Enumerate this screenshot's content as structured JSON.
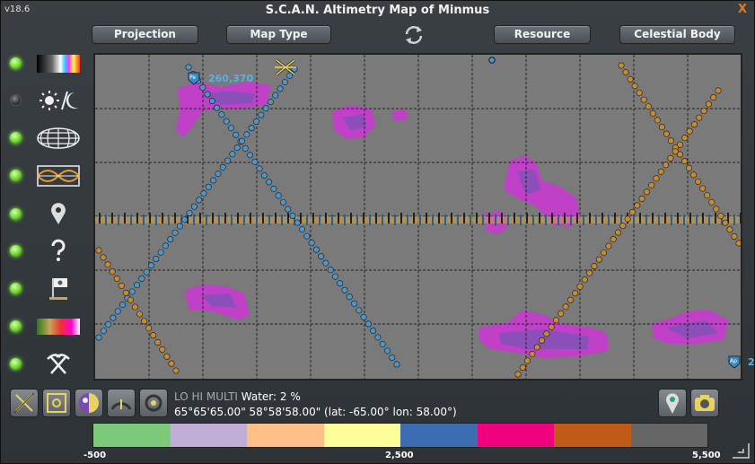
{
  "window": {
    "version": "v18.6",
    "title": "S.C.A.N. Altimetry Map of Minmus",
    "close_label": "X"
  },
  "toolbar": {
    "projection_label": "Projection",
    "map_type_label": "Map Type",
    "resource_label": "Resource",
    "celestial_body_label": "Celestial Body"
  },
  "sidebar": {
    "items": [
      {
        "icon": "color-palette-icon",
        "enabled": true
      },
      {
        "icon": "day-night-icon",
        "enabled": false
      },
      {
        "icon": "grid-icon",
        "enabled": true
      },
      {
        "icon": "orbit-lines-icon",
        "enabled": true
      },
      {
        "icon": "waypoint-icon",
        "enabled": true
      },
      {
        "icon": "anomaly-icon",
        "enabled": true
      },
      {
        "icon": "flag-icon",
        "enabled": true
      },
      {
        "icon": "terrain-legend-icon",
        "enabled": true
      },
      {
        "icon": "mining-icon",
        "enabled": true
      }
    ]
  },
  "map": {
    "marker_pe_label": "Pe",
    "marker_pe_value": "260,370",
    "marker_ap_label": "Ap",
    "marker_ap_value": "2"
  },
  "info": {
    "layers": "LO HI MULTI",
    "water": "Water: 2 %",
    "coords": "65°65'65.00\" 58°58'58.00\" (lat: -65.00° lon: 58.00°)"
  },
  "legend": {
    "colors": [
      "#7dc97b",
      "#c0aed6",
      "#fdbf86",
      "#fdfe99",
      "#3b6db0",
      "#f0027e",
      "#bf5a17",
      "#666666"
    ],
    "min": "-500",
    "mid": "2,500",
    "max": "5,500"
  }
}
